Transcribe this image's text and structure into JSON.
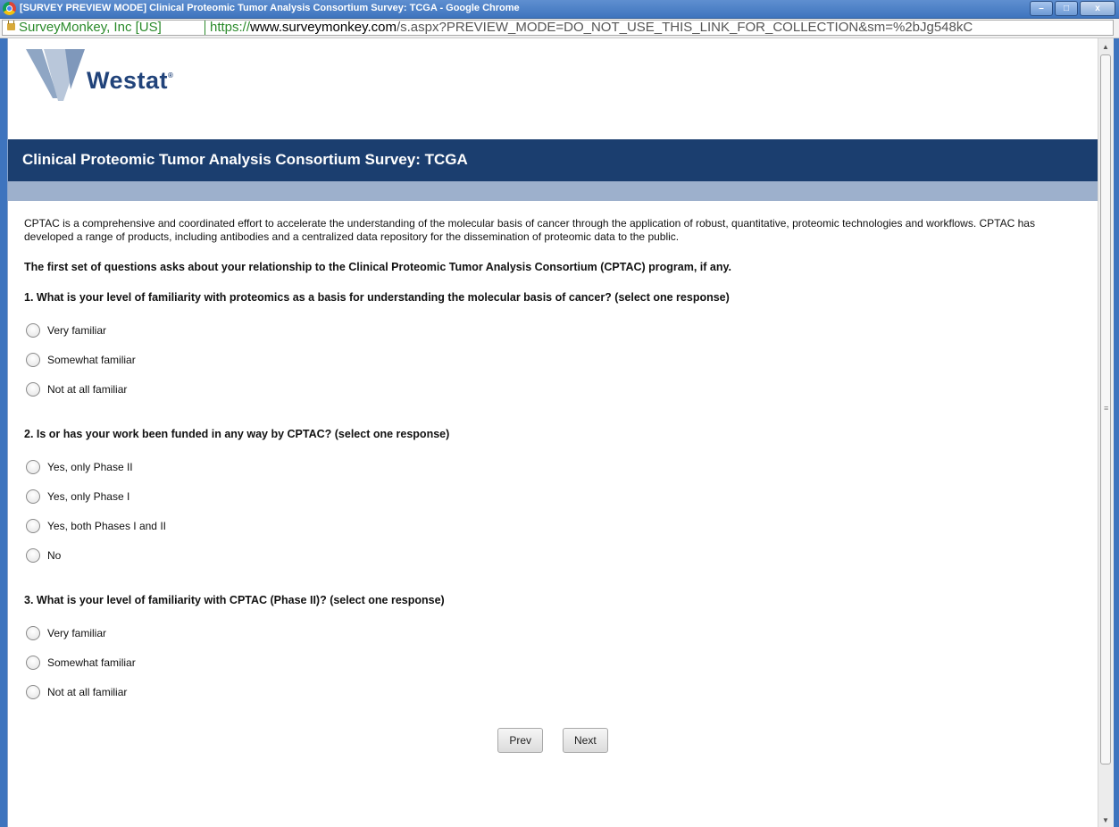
{
  "window": {
    "title": "[SURVEY PREVIEW MODE] Clinical Proteomic Tumor Analysis Consortium Survey: TCGA - Google Chrome",
    "controls": {
      "minimize": "–",
      "maximize": "□",
      "close": "x"
    }
  },
  "address_bar": {
    "ev_label": "SurveyMonkey, Inc [US]",
    "url_scheme": "https://",
    "url_host": "www.surveymonkey.com",
    "url_path": "/s.aspx?PREVIEW_MODE=DO_NOT_USE_THIS_LINK_FOR_COLLECTION&sm=%2bJg548kC"
  },
  "logo": {
    "text": "Westat",
    "mark": "®"
  },
  "banner": {
    "title": "Clinical Proteomic Tumor Analysis Consortium Survey: TCGA"
  },
  "intro": "CPTAC is a comprehensive and coordinated effort to accelerate the understanding of the molecular basis of cancer through the application of robust, quantitative, proteomic technologies and workflows. CPTAC has developed a range of products, including antibodies and a centralized data repository for the dissemination of proteomic data to the public.",
  "section_heading": "The first set of questions asks about your relationship to the Clinical Proteomic Tumor Analysis Consortium (CPTAC) program, if any.",
  "questions": [
    {
      "text": "1. What is your level of familiarity with proteomics as a basis for understanding the molecular basis of cancer? (select one response)",
      "options": [
        "Very familiar",
        "Somewhat familiar",
        "Not at all familiar"
      ]
    },
    {
      "text": "2. Is or has your work been funded in any way by CPTAC? (select one response)",
      "options": [
        "Yes, only Phase II",
        "Yes, only Phase I",
        "Yes, both Phases I and II",
        "No"
      ]
    },
    {
      "text": "3. What is your level of familiarity with CPTAC (Phase II)? (select one response)",
      "options": [
        "Very familiar",
        "Somewhat familiar",
        "Not at all familiar"
      ]
    }
  ],
  "nav": {
    "prev": "Prev",
    "next": "Next"
  }
}
